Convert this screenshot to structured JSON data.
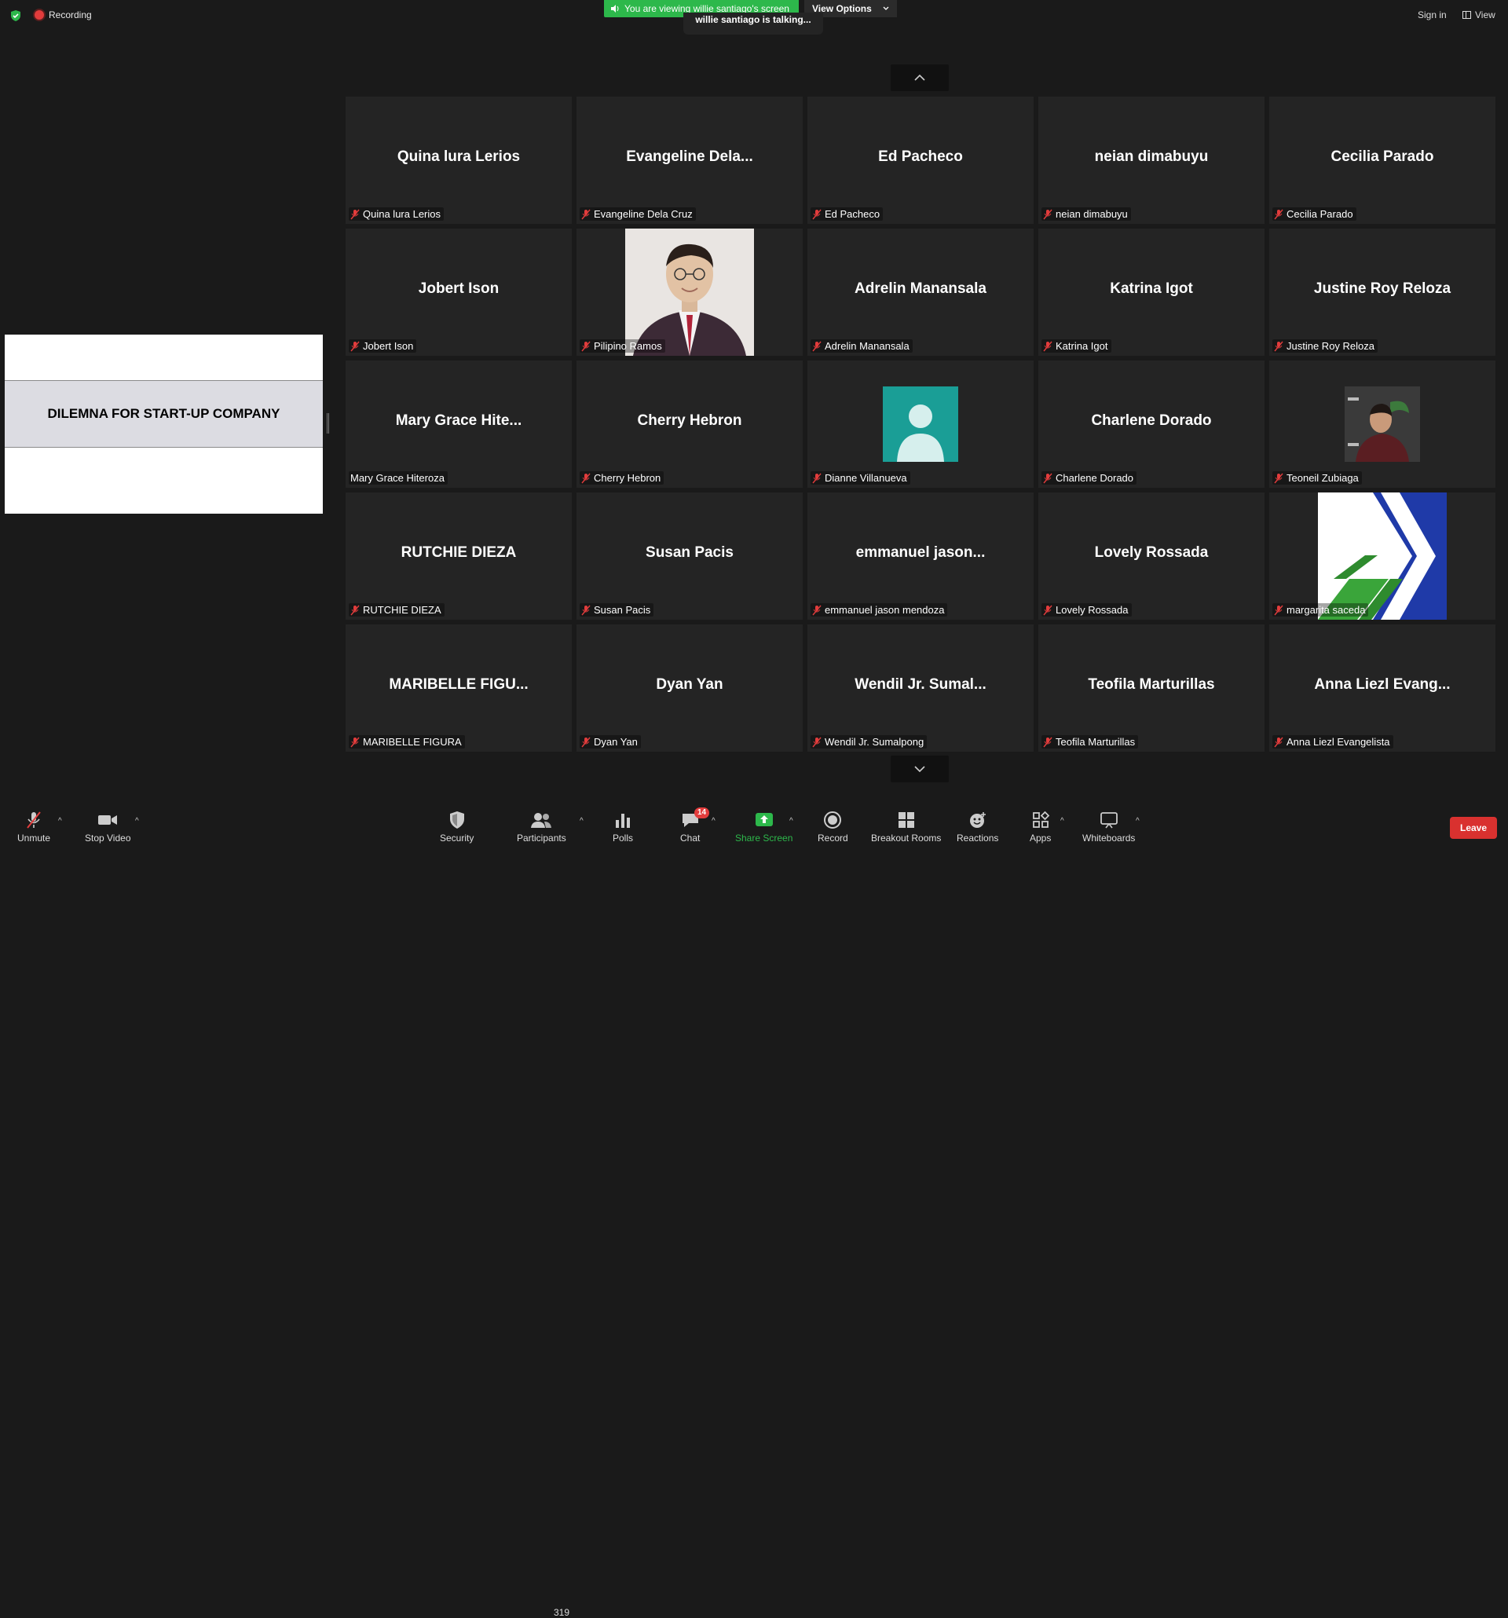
{
  "topbar": {
    "recording_label": "Recording",
    "viewing_banner": "You are viewing willie santiago's screen",
    "view_options_label": "View Options",
    "talking_label": "willie santiago is talking...",
    "sign_in": "Sign in",
    "view_label": "View"
  },
  "share": {
    "slide_title": "DILEMNA FOR START-UP COMPANY"
  },
  "tiles": [
    {
      "display": "Quina lura Lerios",
      "label": "Quina lura Lerios"
    },
    {
      "display": "Evangeline  Dela...",
      "label": "Evangeline Dela Cruz"
    },
    {
      "display": "Ed Pacheco",
      "label": "Ed Pacheco"
    },
    {
      "display": "neian dimabuyu",
      "label": "neian dimabuyu"
    },
    {
      "display": "Cecilia Parado",
      "label": "Cecilia Parado"
    },
    {
      "display": "Jobert Ison",
      "label": "Jobert Ison"
    },
    {
      "display": "",
      "label": "Pilipino Ramos"
    },
    {
      "display": "Adrelin Manansala",
      "label": "Adrelin Manansala"
    },
    {
      "display": "Katrina Igot",
      "label": "Katrina Igot"
    },
    {
      "display": "Justine Roy Reloza",
      "label": "Justine Roy Reloza"
    },
    {
      "display": "Mary Grace Hite...",
      "label": "Mary Grace Hiteroza"
    },
    {
      "display": "Cherry Hebron",
      "label": "Cherry Hebron"
    },
    {
      "display": "",
      "label": "Dianne Villanueva"
    },
    {
      "display": "Charlene Dorado",
      "label": "Charlene Dorado"
    },
    {
      "display": "",
      "label": "Teoneil Zubiaga"
    },
    {
      "display": "RUTCHIE DIEZA",
      "label": "RUTCHIE DIEZA"
    },
    {
      "display": "Susan Pacis",
      "label": "Susan Pacis"
    },
    {
      "display": "emmanuel  jason...",
      "label": "emmanuel jason mendoza"
    },
    {
      "display": "Lovely Rossada",
      "label": "Lovely Rossada"
    },
    {
      "display": "",
      "label": "margarita saceda"
    },
    {
      "display": "MARIBELLE  FIGU...",
      "label": "MARIBELLE FIGURA"
    },
    {
      "display": "Dyan Yan",
      "label": "Dyan Yan"
    },
    {
      "display": "Wendil Jr. Sumal...",
      "label": "Wendil Jr. Sumalpong"
    },
    {
      "display": "Teofila Marturillas",
      "label": "Teofila Marturillas"
    },
    {
      "display": "Anna  Liezl  Evang...",
      "label": "Anna Liezl Evangelista"
    }
  ],
  "toolbar": {
    "unmute": "Unmute",
    "stop_video": "Stop Video",
    "security": "Security",
    "participants": "Participants",
    "participants_count": "319",
    "polls": "Polls",
    "chat": "Chat",
    "chat_badge": "14",
    "share_screen": "Share Screen",
    "record": "Record",
    "breakout_rooms": "Breakout Rooms",
    "reactions": "Reactions",
    "apps": "Apps",
    "whiteboards": "Whiteboards",
    "leave": "Leave"
  },
  "colors": {
    "banner_green": "#2db84b",
    "leave_red": "#d9312f",
    "tile_bg": "#242424",
    "avatar_teal": "#1a9e96"
  }
}
